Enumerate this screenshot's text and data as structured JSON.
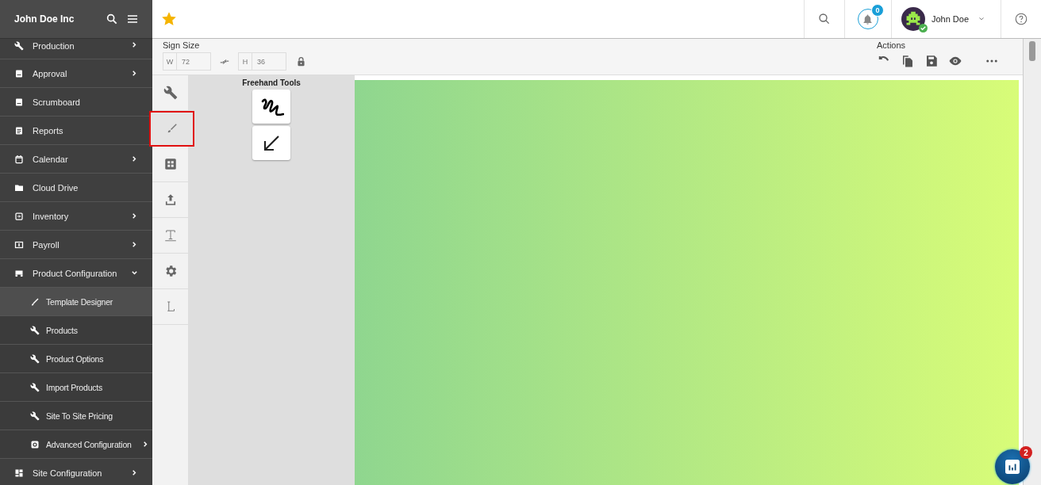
{
  "brand": "John Doe Inc",
  "sidebar": {
    "items": [
      {
        "label": "Production",
        "submenu": true,
        "expanded": false,
        "selected": false
      },
      {
        "label": "Approval",
        "submenu": true,
        "expanded": false,
        "selected": false
      },
      {
        "label": "Scrumboard",
        "submenu": false,
        "selected": false
      },
      {
        "label": "Reports",
        "submenu": false,
        "selected": false
      },
      {
        "label": "Calendar",
        "submenu": true,
        "expanded": false,
        "selected": false
      },
      {
        "label": "Cloud Drive",
        "submenu": false,
        "selected": false
      },
      {
        "label": "Inventory",
        "submenu": true,
        "expanded": false,
        "selected": false
      },
      {
        "label": "Payroll",
        "submenu": true,
        "expanded": false,
        "selected": false
      },
      {
        "label": "Product Configuration",
        "submenu": true,
        "expanded": true,
        "selected": false,
        "children": [
          {
            "label": "Template Designer",
            "submenu": false,
            "selected": true
          },
          {
            "label": "Products",
            "submenu": false,
            "selected": false
          },
          {
            "label": "Product Options",
            "submenu": false,
            "selected": false
          },
          {
            "label": "Import Products",
            "submenu": false,
            "selected": false
          },
          {
            "label": "Site To Site Pricing",
            "submenu": false,
            "selected": false
          },
          {
            "label": "Advanced Configuration",
            "submenu": true,
            "selected": false
          }
        ]
      },
      {
        "label": "Site Configuration",
        "submenu": true,
        "expanded": false,
        "selected": false
      }
    ]
  },
  "topbar": {
    "favorite": true,
    "notifications": "0",
    "user": "John Doe",
    "user_online": true
  },
  "sign_size": {
    "label": "Sign Size",
    "width": {
      "label": "W",
      "value": "72"
    },
    "height": {
      "label": "H",
      "value": "36"
    }
  },
  "actions": {
    "label": "Actions"
  },
  "tools": [
    {
      "selected": false
    },
    {
      "selected": true
    },
    {
      "selected": false
    },
    {
      "selected": false
    },
    {
      "selected": false
    },
    {
      "selected": false
    },
    {
      "selected": false
    }
  ],
  "freehand_tools": {
    "title": "Freehand Tools"
  },
  "reports_badge": "2"
}
